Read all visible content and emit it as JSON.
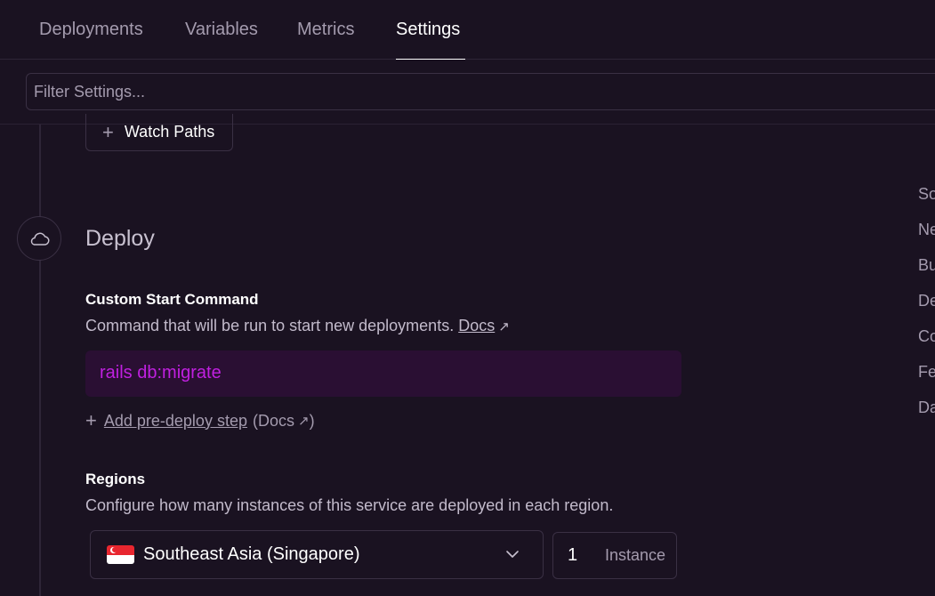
{
  "tabs": [
    {
      "label": "Deployments"
    },
    {
      "label": "Variables"
    },
    {
      "label": "Metrics"
    },
    {
      "label": "Settings"
    }
  ],
  "filter": {
    "placeholder": "Filter Settings..."
  },
  "watch_paths": {
    "label": "Watch Paths",
    "icon": "plus-icon"
  },
  "deploy": {
    "title": "Deploy",
    "icon": "cloud-icon",
    "start_command": {
      "title": "Custom Start Command",
      "description": "Command that will be run to start new deployments.",
      "docs_label": "Docs",
      "value": "rails db:migrate"
    },
    "predeploy": {
      "label": "Add pre-deploy step",
      "docs_prefix": "(Docs",
      "docs_suffix": ")"
    },
    "regions": {
      "title": "Regions",
      "description": "Configure how many instances of this service are deployed in each region.",
      "selected": "Southeast Asia (Singapore)",
      "instances": "1",
      "instance_unit": "Instance"
    }
  },
  "side_nav": [
    "So",
    "Ne",
    "Bu",
    "De",
    "Co",
    "Fe",
    "Da"
  ],
  "colors": {
    "background": "#1a1221",
    "command_bg": "#2a0f33",
    "command_text": "#c020e0"
  }
}
